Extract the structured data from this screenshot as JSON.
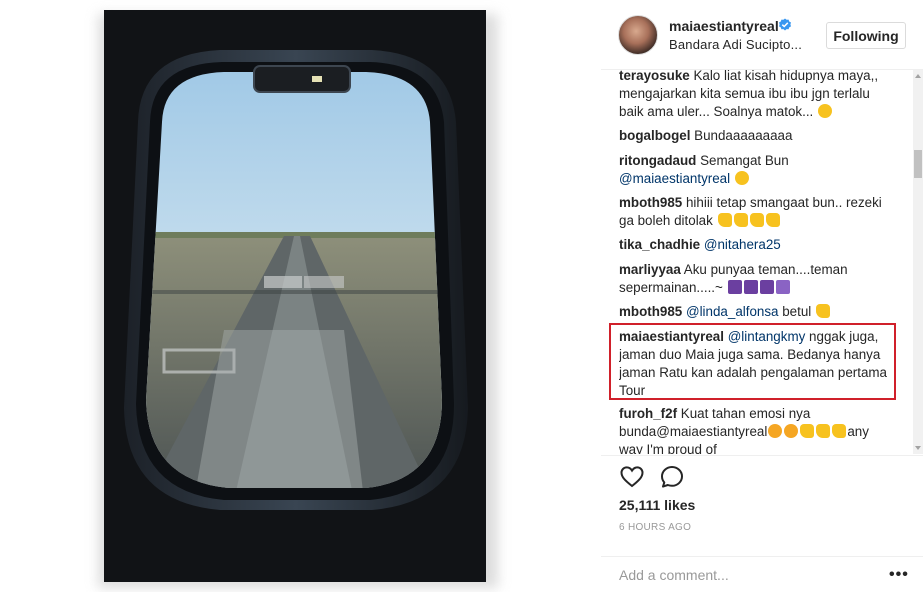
{
  "header": {
    "username": "maiaestiantyreal",
    "location": "Bandara Adi Sucipto...",
    "follow_label": "Following"
  },
  "comments": [
    {
      "user": "terayosuke",
      "text": "Kalo liat kisah hidupnya maya,, mengajarkan kita semua ibu ibu jgn terlalu baik ama uler... Soalnya matok...",
      "emoji": [
        "face"
      ]
    },
    {
      "user": "bogalbogel",
      "text": "Bundaaaaaaaaa",
      "emoji": []
    },
    {
      "user": "ritongadaud",
      "text": "Semangat Bun",
      "mention": "@maiaestiantyreal",
      "emoji": [
        "face"
      ]
    },
    {
      "user": "mboth985",
      "text": "hihiii tetap smangaat bun.. rezeki ga boleh ditolak",
      "emoji": [
        "yel",
        "yel",
        "yel",
        "yel"
      ]
    },
    {
      "user": "tika_chadhie",
      "mention": "@nitahera25",
      "text": "",
      "emoji": []
    },
    {
      "user": "marliyyaa",
      "text": "Aku punyaa teman....teman sepermainan.....~",
      "emoji": [
        "purp",
        "purp",
        "purp",
        "purp2"
      ]
    },
    {
      "user": "mboth985",
      "mention": "@linda_alfonsa",
      "text": "betul",
      "emoji": [
        "yel"
      ]
    },
    {
      "user": "maiaestiantyreal",
      "mention": "@lintangkmy",
      "text": "nggak juga, jaman duo Maia juga sama. Bedanya hanya jaman Ratu kan adalah pengalaman pertama Tour",
      "emoji": []
    },
    {
      "user": "furoh_f2f",
      "text": "Kuat tahan emosi nya bunda@maiaestiantyreal",
      "text2": "any way I'm proud of",
      "emoji": [
        "kiss",
        "kiss",
        "yel",
        "yel",
        "yel"
      ]
    }
  ],
  "actions": {
    "likes": "25,111 likes",
    "time": "6 HOURS AGO",
    "comment_placeholder": "Add a comment...",
    "more_label": "•••"
  },
  "icons": {
    "verified": "verified-badge-icon",
    "like": "heart-icon",
    "comment": "comment-bubble-icon",
    "more": "more-options-icon"
  },
  "colors": {
    "verified": "#3897f0",
    "highlight_border": "#d0202a",
    "mention": "#003569"
  }
}
